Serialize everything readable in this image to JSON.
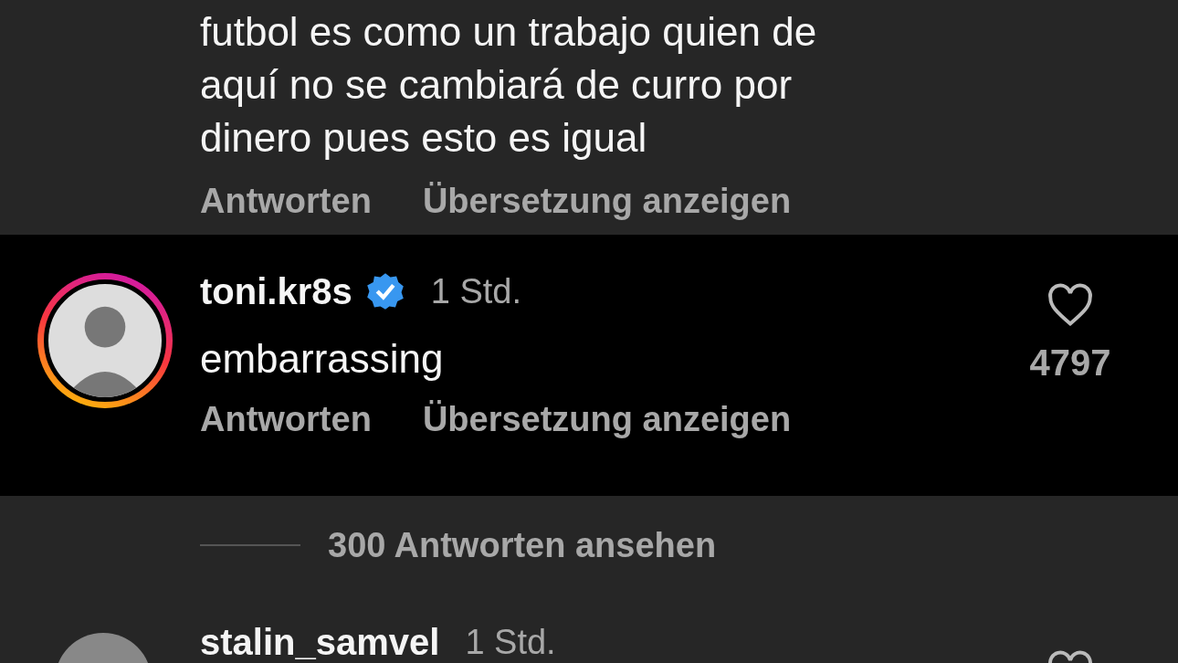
{
  "previous_comment": {
    "text_lines": [
      "futbol es como un trabajo quien de",
      "aquí no se cambiará de curro por",
      "dinero pues esto es igual"
    ],
    "actions": [
      "Antworten",
      "Übersetzung anzeigen"
    ]
  },
  "highlighted_comment": {
    "username": "toni.kr8s",
    "verified": true,
    "time": "1 Std.",
    "text": "embarrassing",
    "actions": [
      "Antworten",
      "Übersetzung anzeigen"
    ],
    "likes": "4797",
    "liked": false,
    "has_story": true
  },
  "view_replies": "300 Antworten ansehen",
  "next_comment": {
    "username": "stalin_samvel",
    "time": "1 Std."
  }
}
